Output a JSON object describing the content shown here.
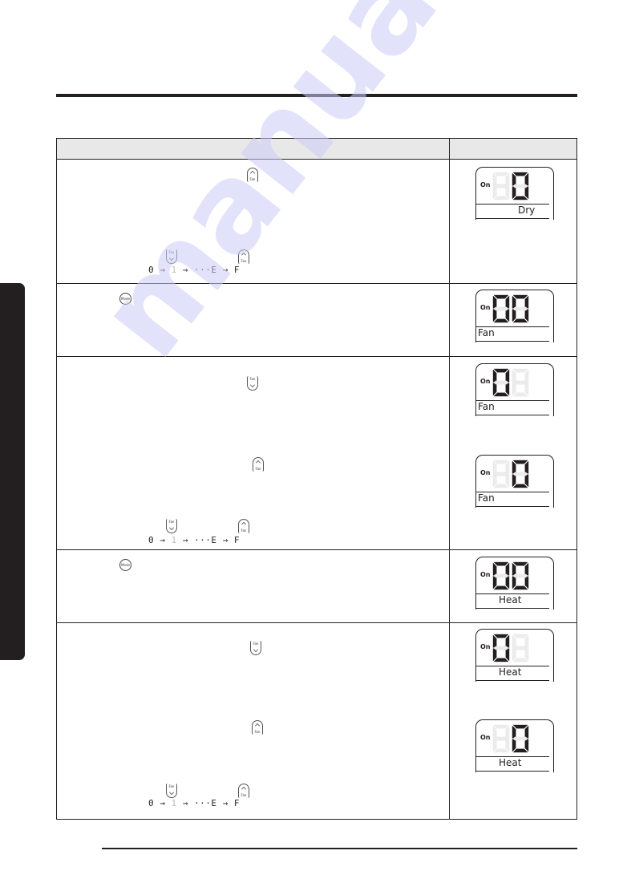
{
  "page": {
    "header_row": {
      "col1": "",
      "col2": ""
    }
  },
  "icons": {
    "fan_up": "fan-up-button",
    "fan_down": "fan-down-button",
    "mode": "mode-button",
    "fan_label": "Fan",
    "mode_label": "Mode"
  },
  "sequence": {
    "s0": "0",
    "arrow": "→",
    "s1": "1",
    "ellipsis": "···",
    "sE": "E",
    "sF": "F"
  },
  "rows": [
    {
      "displays": [
        {
          "on_label": "On",
          "digits": [
            " ",
            "0"
          ],
          "mode": "Dry"
        }
      ]
    },
    {
      "displays": [
        {
          "on_label": "On",
          "digits": [
            "0",
            "0"
          ],
          "mode": "Fan"
        }
      ]
    },
    {
      "displays": [
        {
          "on_label": "On",
          "digits": [
            "0",
            " "
          ],
          "mode": "Fan"
        },
        {
          "on_label": "On",
          "digits": [
            " ",
            "0"
          ],
          "mode": "Fan"
        }
      ]
    },
    {
      "displays": [
        {
          "on_label": "On",
          "digits": [
            "0",
            "0"
          ],
          "mode": "Heat"
        }
      ]
    },
    {
      "displays": [
        {
          "on_label": "On",
          "digits": [
            "0",
            " "
          ],
          "mode": "Heat"
        },
        {
          "on_label": "On",
          "digits": [
            " ",
            "0"
          ],
          "mode": "Heat"
        }
      ]
    }
  ],
  "watermark": "manualslib"
}
